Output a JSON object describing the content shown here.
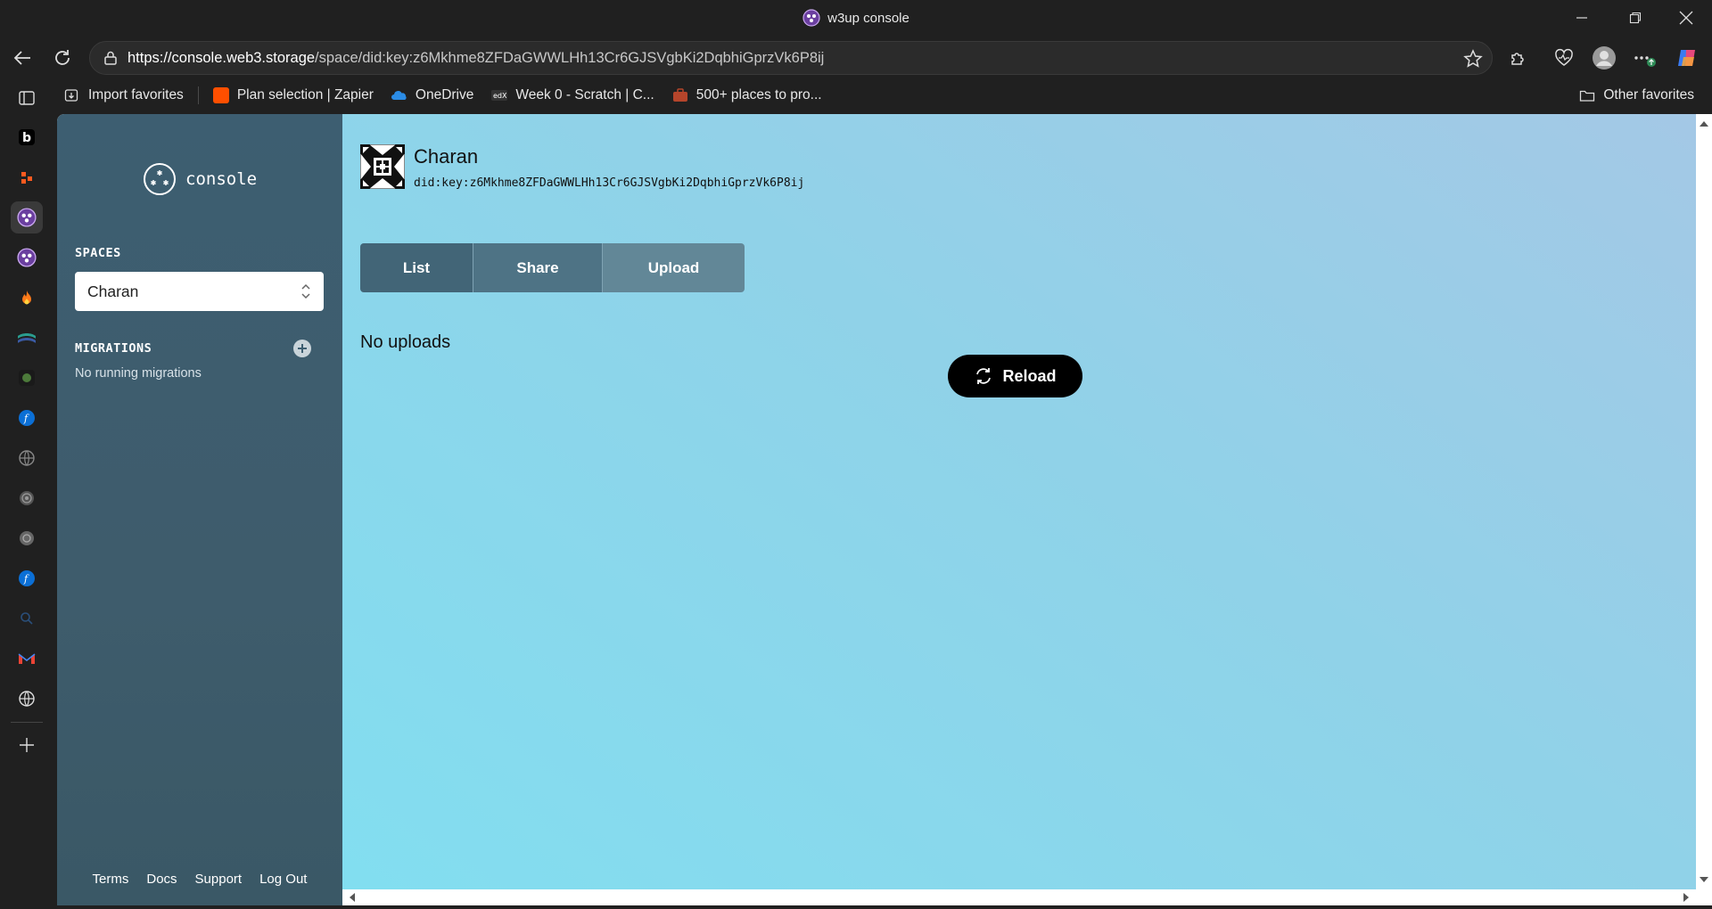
{
  "browser": {
    "window_title": "w3up console",
    "url_host": "https://console.web3.storage",
    "url_path": "/space/did:key:z6Mkhme8ZFDaGWWLHh13Cr6GJSVgbKi2DqbhiGprzVk6P8ij"
  },
  "favorites": {
    "items": [
      {
        "label": "Import favorites",
        "icon": "import-icon"
      },
      {
        "label": "Plan selection | Zapier",
        "icon": "zapier-icon"
      },
      {
        "label": "OneDrive",
        "icon": "onedrive-icon"
      },
      {
        "label": "Week 0 - Scratch | C...",
        "icon": "edx-icon"
      },
      {
        "label": "500+ places to pro...",
        "icon": "briefcase-icon"
      }
    ],
    "other": "Other favorites"
  },
  "sidebar": {
    "logo_text": "console",
    "spaces_label": "SPACES",
    "selected_space": "Charan",
    "migrations_label": "MIGRATIONS",
    "no_migrations": "No running migrations",
    "footer": [
      "Terms",
      "Docs",
      "Support",
      "Log Out"
    ]
  },
  "main": {
    "space_name": "Charan",
    "space_did": "did:key:z6Mkhme8ZFDaGWWLHh13Cr6GJSVgbKi2DqbhiGprzVk6P8ij",
    "tabs": [
      "List",
      "Share",
      "Upload"
    ],
    "empty_message": "No uploads",
    "reload_label": "Reload"
  },
  "colors": {
    "sidebar": "#3d5e71",
    "tab_list": "#426577",
    "tab_share": "#4e7385",
    "tab_upload": "#628797",
    "reload_bg": "#000000"
  }
}
